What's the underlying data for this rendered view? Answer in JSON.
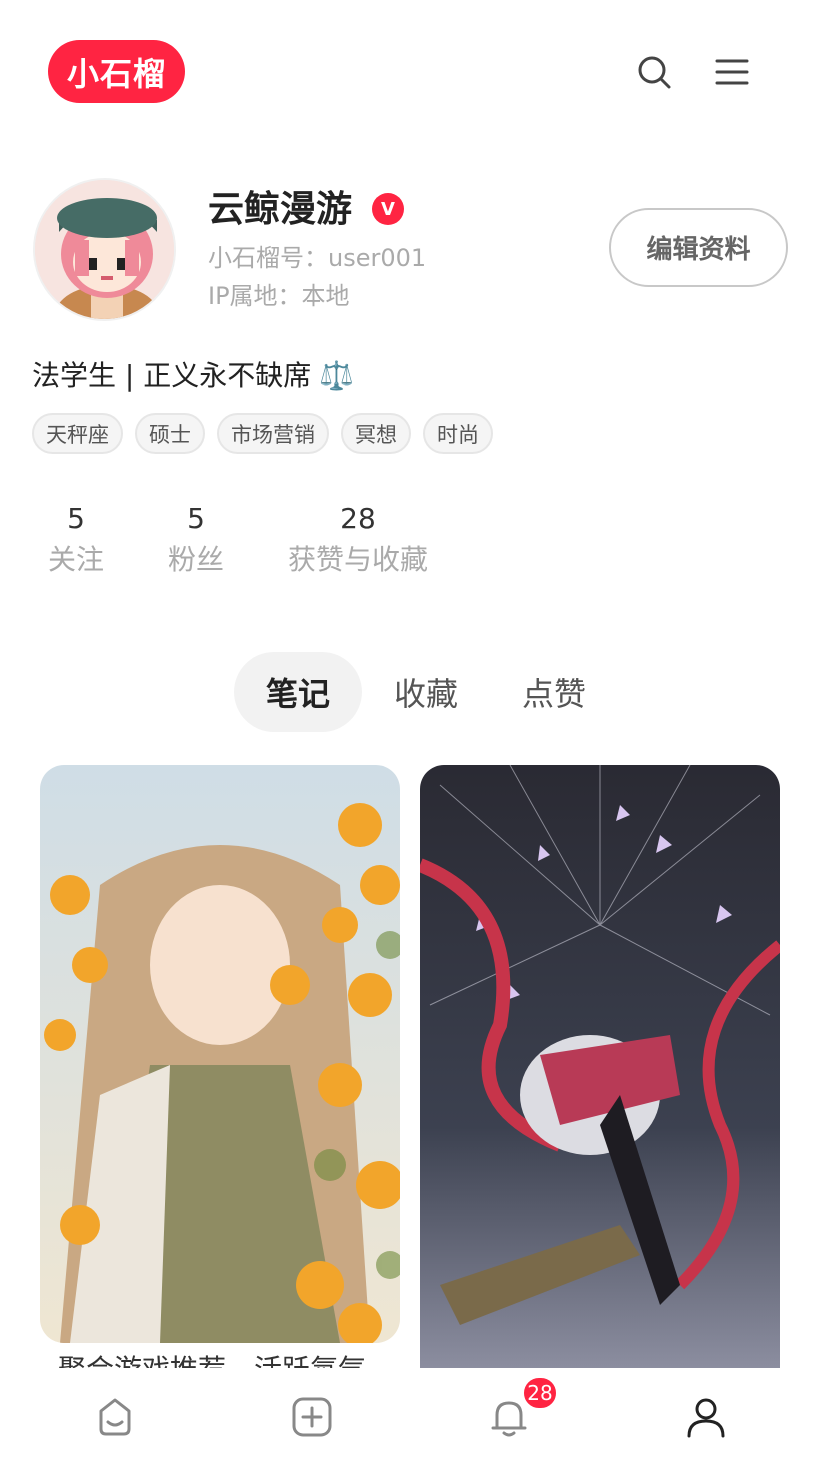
{
  "header": {
    "logo_text": "小石榴",
    "icons": [
      "search-icon",
      "menu-icon"
    ]
  },
  "profile": {
    "username": "云鲸漫游",
    "verified_badge": "V",
    "id_line": "小石榴号：user001",
    "ip_line": "IP属地：本地",
    "edit_button": "编辑资料",
    "bio": "法学生 | 正义永不缺席",
    "bio_emoji": "⚖️",
    "tags": [
      "天秤座",
      "硕士",
      "市场营销",
      "冥想",
      "时尚"
    ]
  },
  "stats": [
    {
      "value": "5",
      "label": "关注"
    },
    {
      "value": "5",
      "label": "粉丝"
    },
    {
      "value": "28",
      "label": "获赞与收藏"
    }
  ],
  "tabs": [
    {
      "label": "笔记",
      "active": true
    },
    {
      "label": "收藏",
      "active": false
    },
    {
      "label": "点赞",
      "active": false
    }
  ],
  "notes": [
    {
      "title": "聚合游戏推荐，活跃氛气"
    }
  ],
  "bottom_nav": {
    "items": [
      "home-icon",
      "add-note-icon",
      "notification-icon",
      "profile-icon"
    ],
    "notification_count": "28"
  },
  "colors": {
    "brand": "#ff2442",
    "muted_text": "#aaaaaa"
  }
}
